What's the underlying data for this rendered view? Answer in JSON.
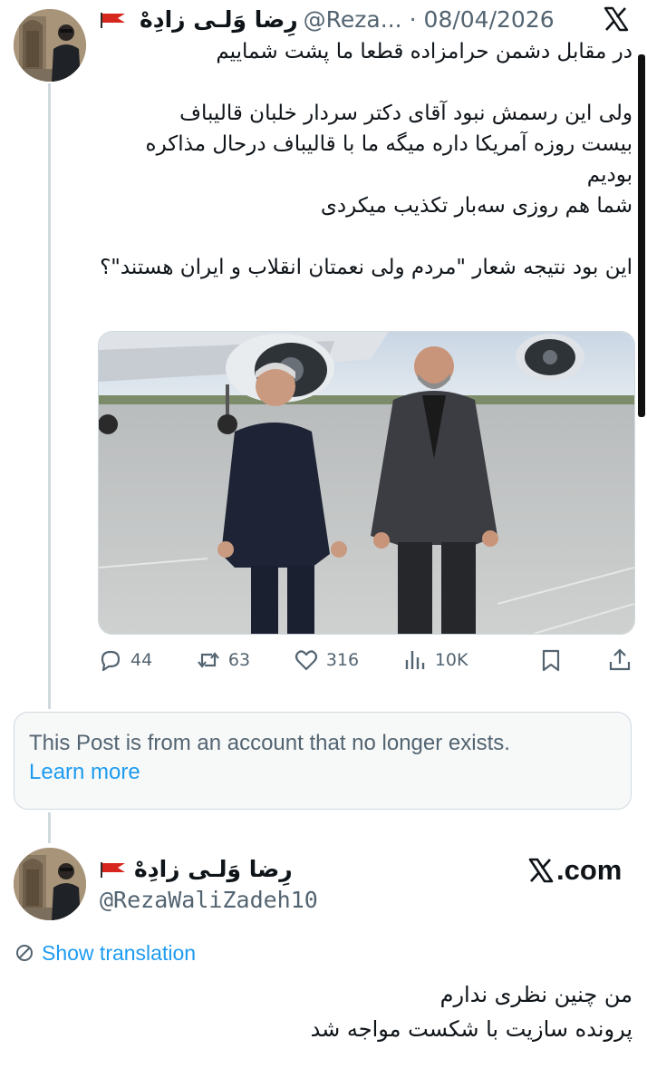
{
  "post": {
    "display_name": "رِضا وَلـی زادِهْ",
    "handle": "@Reza...",
    "separator": "·",
    "date": "08/04/2026",
    "text": "در مقابل دشمن حرامزاده قطعا ما پشت شماییم\n\nولی این رسمش نبود آقای دکتر سردار خلبان قالیباف\nبیست روزه آمریکا داره میگه ما با قالیباف درحال مذاکره بودیم\nشما هم روزی سه‌بار تکذیب میکردی\n\nاین بود نتیجه شعار \"مردم ولی نعمتان انقلاب و ایران هستند\"؟",
    "stats": {
      "replies": "44",
      "reposts": "63",
      "likes": "316",
      "views": "10K"
    }
  },
  "notice": {
    "message": "This Post is from an account that no longer exists.",
    "link": "Learn more"
  },
  "reply": {
    "display_name": "رِضا وَلـی زادِهْ",
    "handle": "@RezaWaliZadeh10",
    "site": ".com",
    "translation_label": "Show translation",
    "text": "من چنین نظری ندارم\nپرونده سازیت با شکست مواجه شد"
  },
  "icons": {
    "x_logo": "x-logo-icon",
    "flag": "red-flag-icon",
    "reply": "reply-icon",
    "repost": "repost-icon",
    "like": "heart-icon",
    "views": "views-icon",
    "bookmark": "bookmark-icon",
    "share": "share-icon",
    "translate": "translate-icon"
  },
  "colors": {
    "link": "#1d9bf0",
    "muted": "#536471",
    "flag": "#d7261e"
  }
}
